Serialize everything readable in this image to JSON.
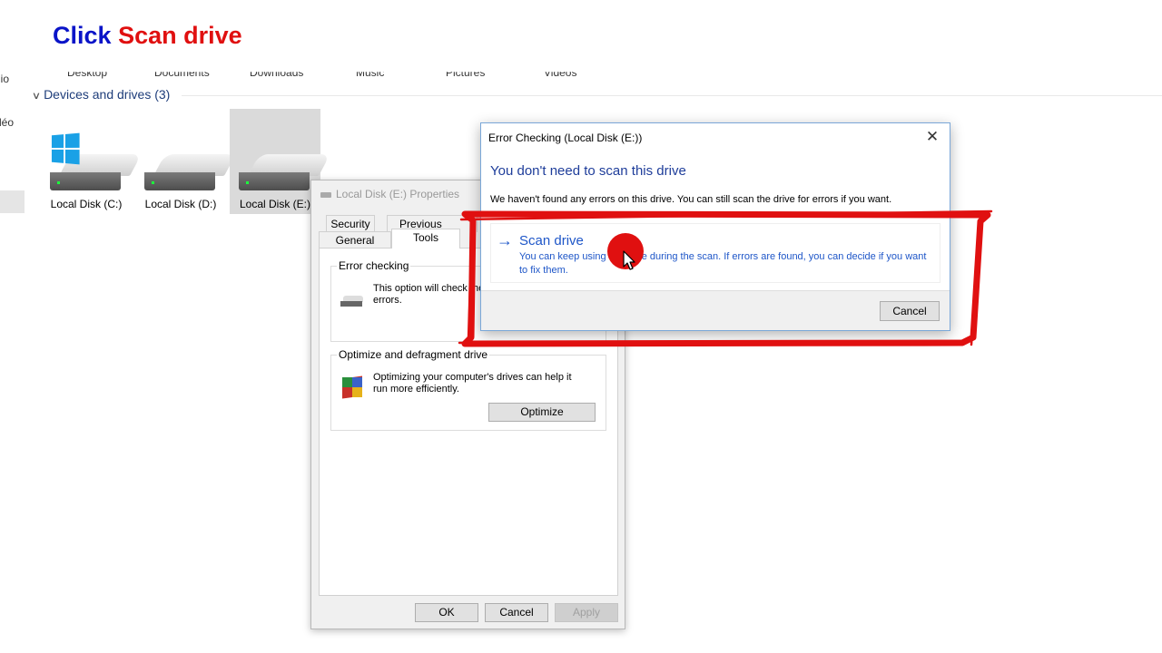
{
  "caption": {
    "word1": "Click",
    "word2": "Scan drive"
  },
  "explorer": {
    "nav_fragments": [
      "dio",
      "déo"
    ],
    "folders": [
      "Desktop",
      "Documents",
      "Downloads",
      "Music",
      "Pictures",
      "Videos"
    ],
    "group_header": "Devices and drives (3)",
    "drives": [
      {
        "label": "Local Disk (C:)",
        "icon": "windows-drive-icon"
      },
      {
        "label": "Local Disk (D:)",
        "icon": "hard-drive-icon"
      },
      {
        "label": "Local Disk (E:)",
        "icon": "hard-drive-icon",
        "selected": true
      }
    ]
  },
  "properties": {
    "title": "Local Disk (E:) Properties",
    "tabs_back": [
      "Security",
      "Previous Versions"
    ],
    "tabs_front": [
      "General",
      "Tools"
    ],
    "active_tab": "Tools",
    "error_checking": {
      "title": "Error checking",
      "text": "This option will check the drive for file system errors."
    },
    "optimize": {
      "title": "Optimize and defragment drive",
      "text": "Optimizing your computer's drives can help it run more efficiently.",
      "button": "Optimize"
    },
    "buttons": {
      "ok": "OK",
      "cancel": "Cancel",
      "apply": "Apply"
    }
  },
  "error_dialog": {
    "title": "Error Checking (Local Disk (E:))",
    "heading": "You don't need to scan this drive",
    "message": "We haven't found any errors on this drive. You can still scan the drive for errors if you want.",
    "option": {
      "label": "Scan drive",
      "description": "You can keep using the drive during the scan. If errors are found, you can decide if you want to fix them."
    },
    "cancel": "Cancel"
  },
  "colors": {
    "caption_blue": "#0a14c8",
    "caption_red": "#e01010",
    "link_blue": "#1e56c8",
    "highlight_red": "#e01010"
  }
}
